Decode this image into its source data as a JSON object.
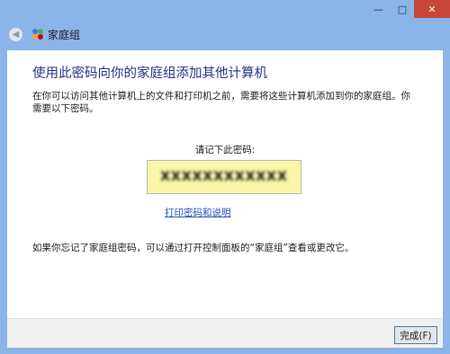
{
  "window": {
    "title_bar_buttons": {
      "minimize": "—",
      "maximize": "□",
      "close": "✕"
    }
  },
  "nav": {
    "title": "家庭组",
    "back_icon": "back-arrow-icon",
    "app_icon": "homegroup-icon"
  },
  "main": {
    "heading": "使用此密码向你的家庭组添加其他计算机",
    "description": "在你可以访问其他计算机上的文件和打印机之前，需要将这些计算机添加到你的家庭组。你需要以下密码。",
    "password_prompt": "请记下此密码:",
    "password_value": "XXXXXXXXXXXX",
    "print_link": "打印密码和说明",
    "footer_note": "如果你忘记了家庭组密码，可以通过打开控制面板的“家庭组”查看或更改它。"
  },
  "buttons": {
    "finish": "完成(F)"
  },
  "colors": {
    "window_frame": "#8bb5e8",
    "heading": "#1e3287",
    "link": "#1a4fbf",
    "password_bg": "#fbf6a8",
    "close_button": "#c7463a"
  }
}
